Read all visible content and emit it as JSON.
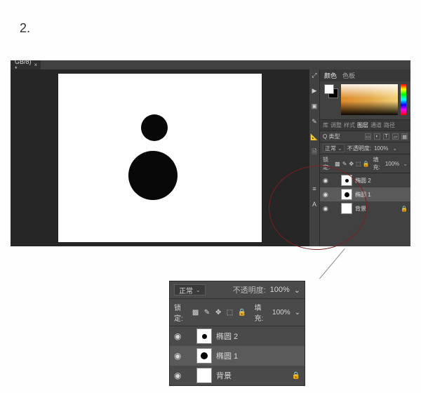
{
  "step_number": "2.",
  "document_tab": {
    "title": "GB/8) *",
    "close": "×"
  },
  "vtoolbar": {
    "tools": [
      "arrows-icon",
      "play-icon",
      "crop-icon",
      "eyedropper-icon",
      "ruler-icon",
      "note-icon",
      "spacer",
      "align-icon",
      "text-icon"
    ]
  },
  "color_panel": {
    "tabs": [
      "颜色",
      "色板"
    ],
    "active_tab": 0
  },
  "layers_panel": {
    "tabs": [
      "库",
      "调整",
      "样式",
      "图层",
      "通道",
      "路径"
    ],
    "active_tab": 3,
    "kind_label": "Q 类型",
    "blend_mode": "正常",
    "opacity_label": "不透明度:",
    "opacity_value": "100%",
    "lock_label": "锁定:",
    "fill_label": "填充:",
    "fill_value": "100%",
    "layers": [
      {
        "visible": true,
        "thumb": "smalldot",
        "name": "椭圆 2",
        "locked": false,
        "selected": false
      },
      {
        "visible": true,
        "thumb": "dot",
        "name": "椭圆 1",
        "locked": false,
        "selected": true
      },
      {
        "visible": true,
        "thumb": "blank",
        "name": "背景",
        "locked": true,
        "selected": false
      }
    ]
  },
  "zoom_panel": {
    "blend_mode": "正常",
    "opacity_label": "不透明度:",
    "opacity_value": "100%",
    "lock_label": "锁定:",
    "fill_label": "填充:",
    "fill_value": "100%",
    "layers": [
      {
        "visible": true,
        "thumb": "smalldot",
        "name": "椭圆 2",
        "locked": false,
        "selected": false
      },
      {
        "visible": true,
        "thumb": "dot",
        "name": "椭圆 1",
        "locked": false,
        "selected": true
      },
      {
        "visible": true,
        "thumb": "blank",
        "name": "背景",
        "locked": true,
        "selected": false
      }
    ]
  },
  "icons": {
    "eye": "◉",
    "lock": "🔒",
    "caret": "⌄"
  }
}
